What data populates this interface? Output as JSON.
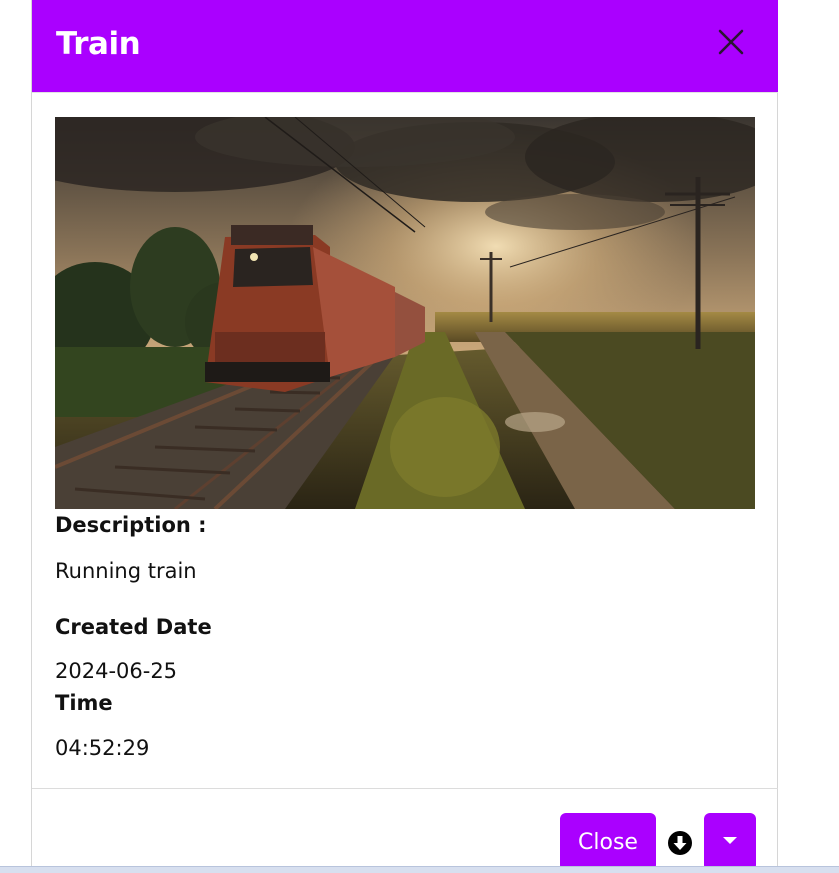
{
  "modal": {
    "title": "Train",
    "image_alt": "Running train",
    "fields": [
      {
        "label": "Description :",
        "value": "Running train"
      },
      {
        "label": "Created Date",
        "value": "2024-06-25"
      },
      {
        "label": "Time",
        "value": "04:52:29"
      }
    ],
    "footer": {
      "close_label": "Close",
      "download_icon": "download-icon",
      "dropdown_icon": "caret-down-icon"
    },
    "close_icon": "close-icon"
  },
  "colors": {
    "accent": "#aa00ff",
    "header_text": "#ffffff",
    "body_text": "#111111"
  }
}
